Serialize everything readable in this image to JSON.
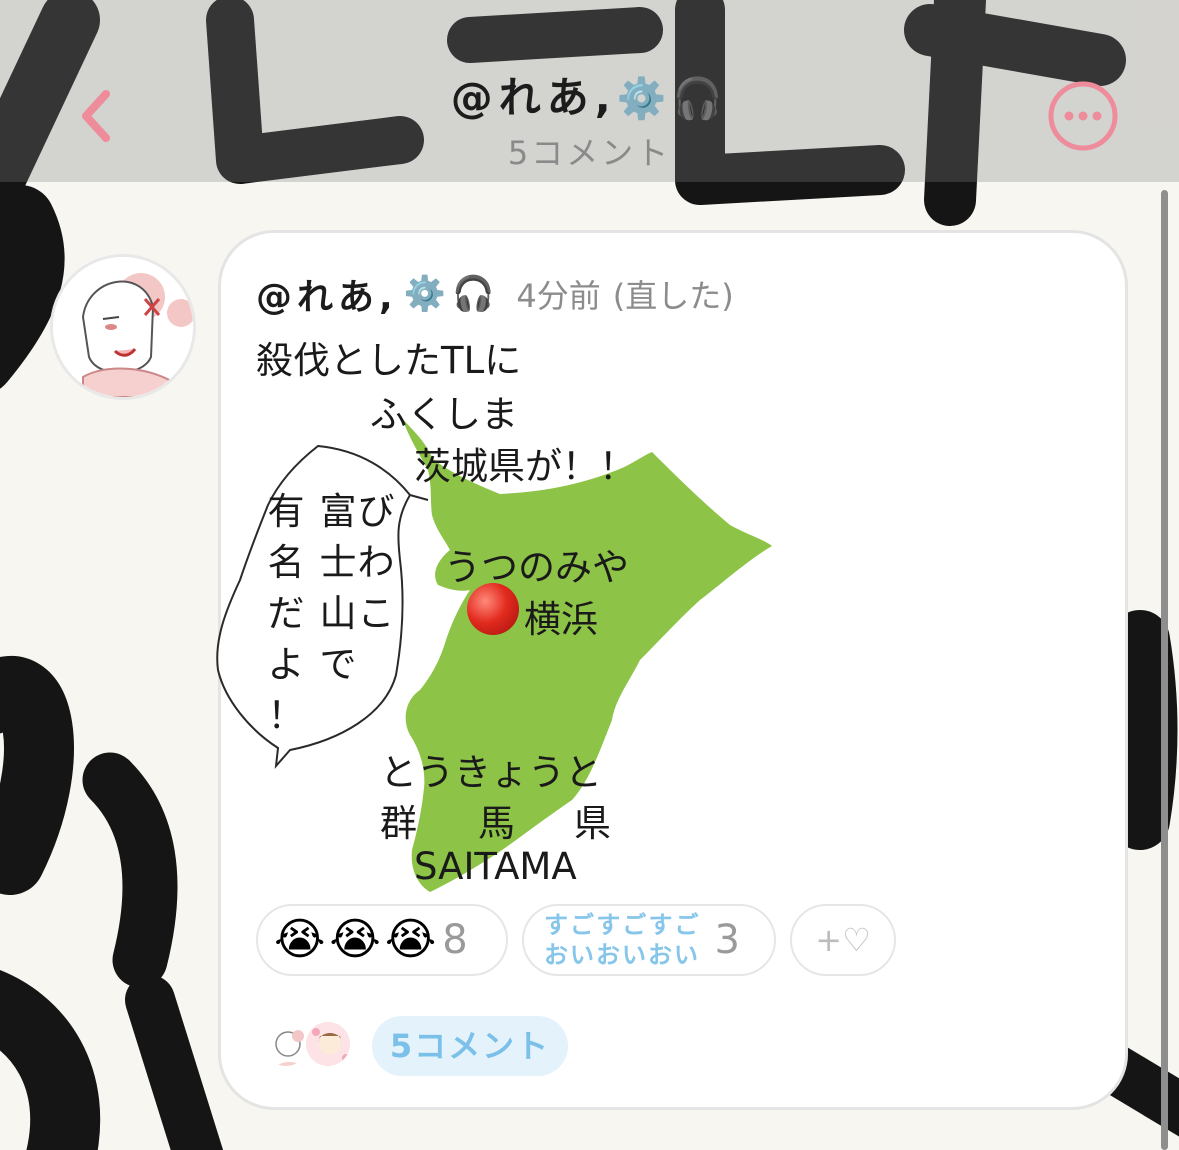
{
  "header": {
    "title": "@れあ,",
    "subtitle": "5コメント"
  },
  "post": {
    "author": "@れあ,",
    "time": "4分前",
    "edited": "(直した)",
    "body": "殺伐としたTLに",
    "map_labels": {
      "fukushima": "ふくしま",
      "ibaraki": "茨城県が！！",
      "utsunomiya": "うつのみや",
      "yokohama": "横浜",
      "tokyo": "とうきょうと",
      "gunma_1": "群",
      "gunma_2": "馬",
      "gunma_3": "県",
      "saitama": "SAITAMA"
    },
    "speech_bubble": {
      "col1": [
        "有",
        "名",
        "だ",
        "よ",
        "！"
      ],
      "col2": [
        "富",
        "士",
        "山",
        "で"
      ],
      "col3": [
        "び",
        "わ",
        "こ"
      ]
    },
    "map_color": "#8dc346"
  },
  "reactions": [
    {
      "type": "emoji",
      "emoji": "😭",
      "repeat": 3,
      "count": "8"
    },
    {
      "type": "text",
      "line1": "すごすごすご",
      "line2": "おいおいおい",
      "count": "3"
    },
    {
      "type": "add",
      "label": "+♡"
    }
  ],
  "comments_button": "5コメント",
  "colors": {
    "accent_pink": "#ef8c9b",
    "comment_blue": "#7bc0e8",
    "comment_bg": "#e3f2fb"
  },
  "icons": [
    "back-chevron-icon",
    "more-dots-icon",
    "gear-icon",
    "headphones-icon",
    "heart-icon"
  ]
}
